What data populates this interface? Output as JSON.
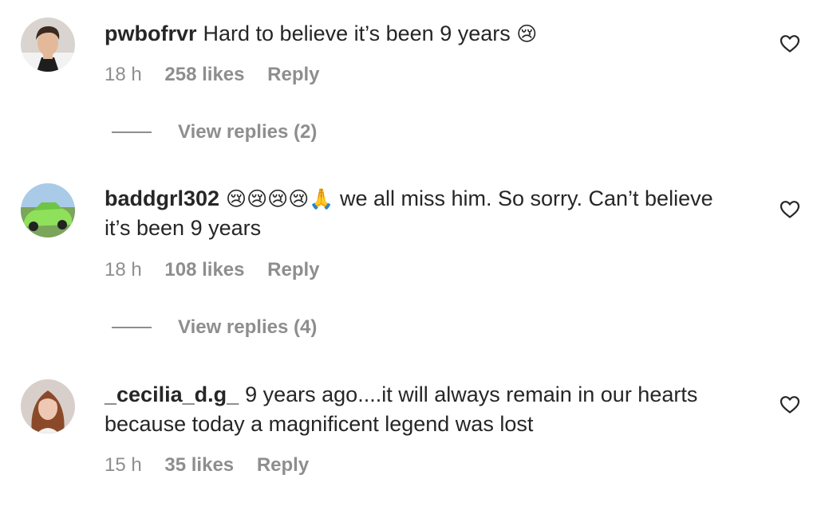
{
  "comments": [
    {
      "username": "pwbofrvr",
      "text": "Hard to believe it’s been 9 years",
      "emoji": "😢",
      "time": "18 h",
      "likes": "258 likes",
      "reply_label": "Reply",
      "view_replies": "View replies (2)"
    },
    {
      "username": "baddgrl302",
      "emoji": "😢😢😢😢🙏",
      "text": "we all miss him. So sorry. Can’t believe it’s been 9 years",
      "time": "18 h",
      "likes": "108 likes",
      "reply_label": "Reply",
      "view_replies": "View replies (4)"
    },
    {
      "username": "_cecilia_d.g_",
      "text": "9 years ago....it will always remain in our hearts because today a magnificent legend was lost",
      "time": "15 h",
      "likes": "35 likes",
      "reply_label": "Reply"
    }
  ],
  "icons": {
    "like": "heart-icon"
  },
  "colors": {
    "text": "#262626",
    "muted": "#8e8e8e"
  }
}
